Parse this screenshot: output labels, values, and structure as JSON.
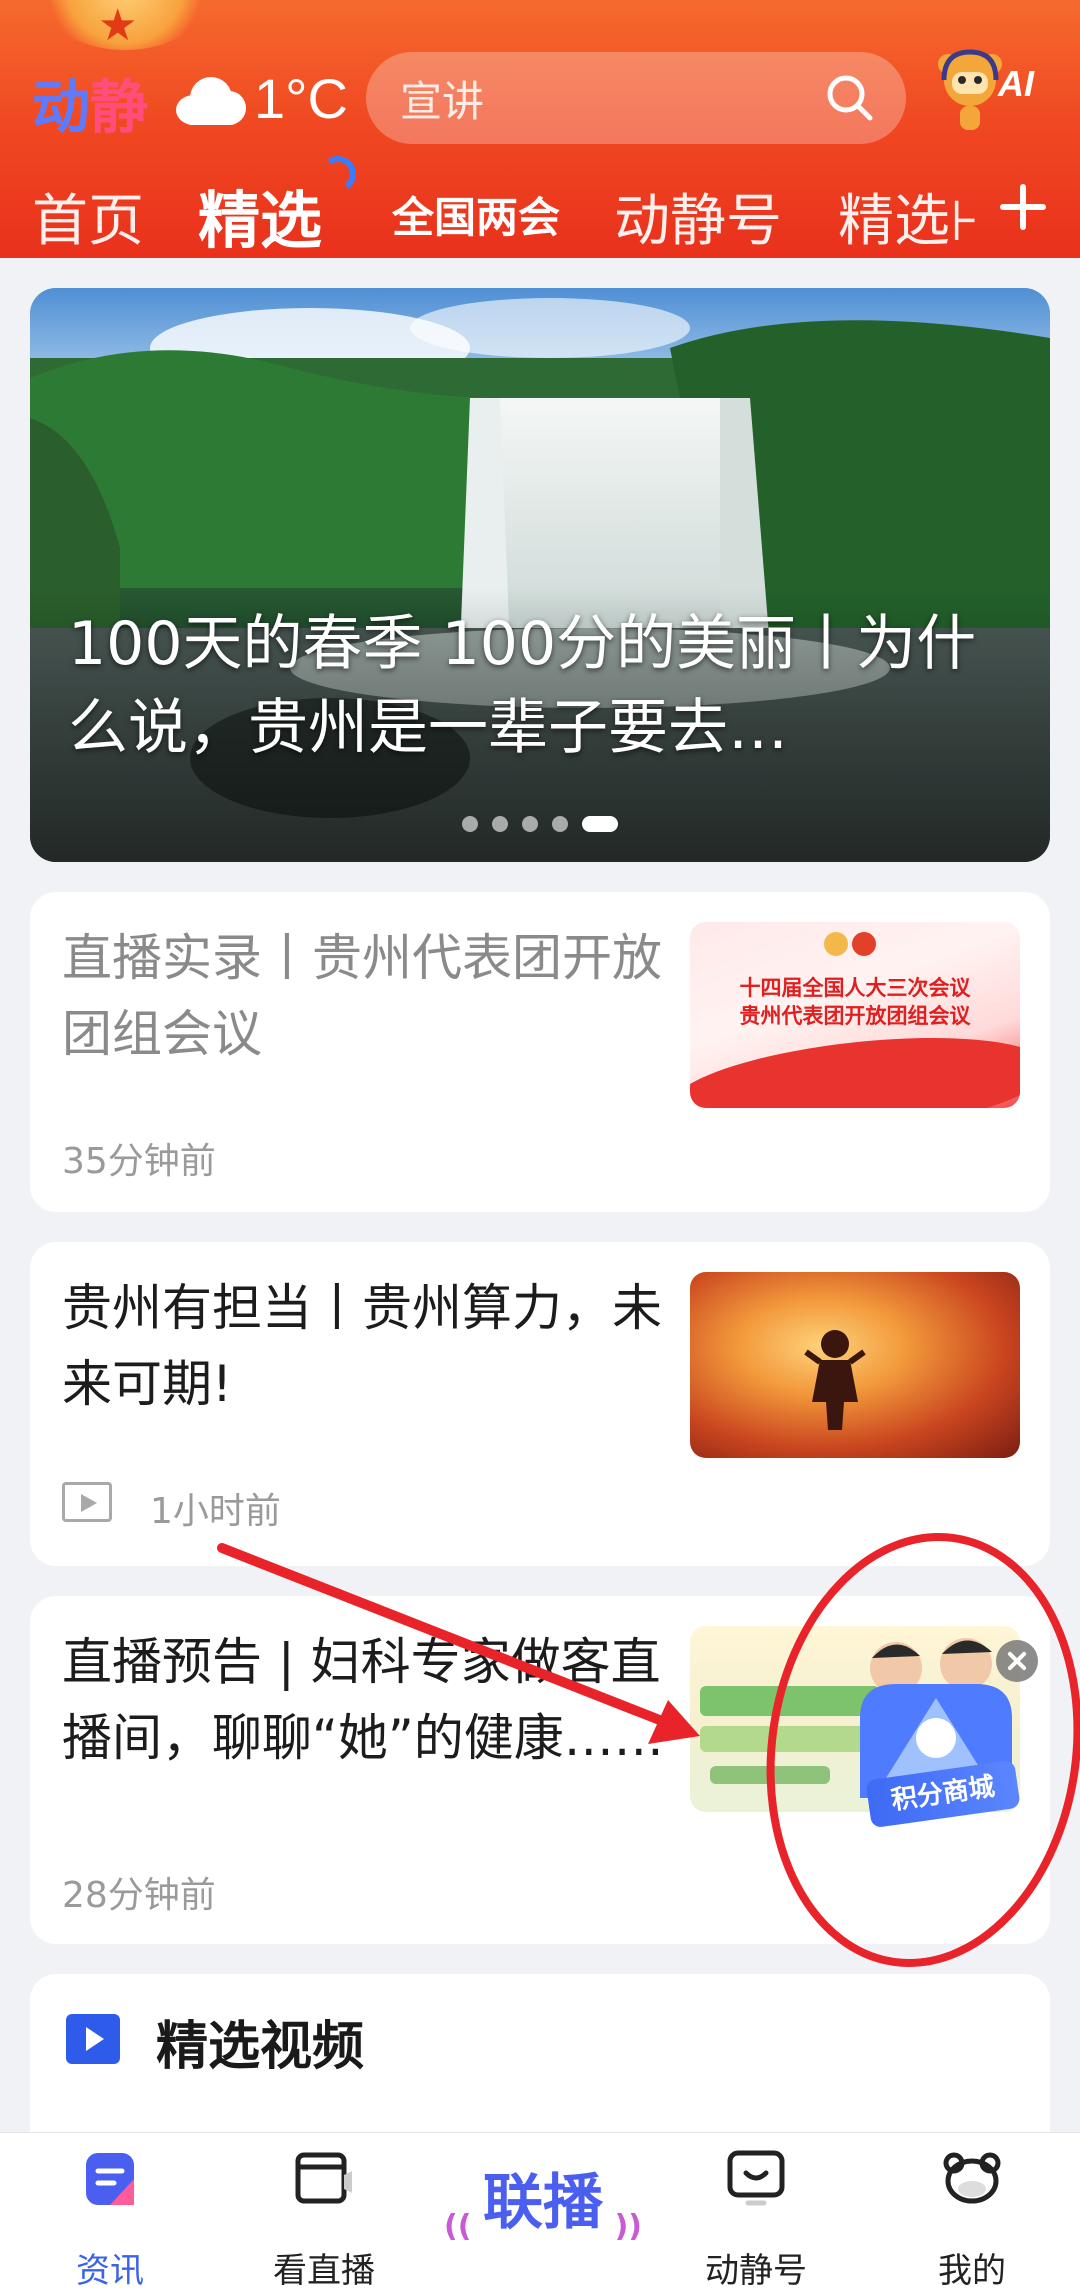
{
  "header": {
    "logo": [
      "动",
      "静"
    ],
    "weather": {
      "icon": "cloud-icon",
      "temperature": "1°C"
    },
    "search": {
      "placeholder": "宣讲",
      "icon": "search-icon"
    },
    "ai_badge": "AI",
    "tabs": [
      {
        "label": "首页",
        "active": false
      },
      {
        "label": "精选",
        "active": true
      },
      {
        "label": "全国两会",
        "active": false
      },
      {
        "label": "动静号",
        "active": false
      },
      {
        "label": "精选⊦",
        "active": false
      }
    ],
    "add_icon": "plus-icon"
  },
  "banner": {
    "title": "100天的春季 100分的美丽丨为什么说，贵州是一辈子要去…",
    "dot_count": 5,
    "active_dot": 5
  },
  "feed": [
    {
      "headline": "直播实录丨贵州代表团开放团组会议",
      "time": "35分钟前",
      "read": true,
      "thumb_text": [
        "十四届全国人大三次会议",
        "贵州代表团开放团组会议"
      ]
    },
    {
      "headline": "贵州有担当丨贵州算力，未来可期!",
      "time": "1小时前",
      "read": false,
      "video": true
    },
    {
      "headline": "直播预告 | 妇科专家做客直播间，聊聊“她”的健康……",
      "time": "28分钟前",
      "read": false
    }
  ],
  "floating_widget": {
    "label": "积分商城",
    "close_icon": "close-icon"
  },
  "video_section": {
    "title": "精选视频",
    "icon": "play-icon"
  },
  "bottom_nav": [
    {
      "label": "资讯",
      "icon": "news-icon",
      "active": true
    },
    {
      "label": "看直播",
      "icon": "live-tv-icon",
      "active": false
    },
    {
      "label": "联播",
      "icon": "lianbo-logo",
      "active": false
    },
    {
      "label": "动静号",
      "icon": "chat-tv-icon",
      "active": false
    },
    {
      "label": "我的",
      "icon": "profile-mascot-icon",
      "active": false
    }
  ],
  "colors": {
    "header_red": "#e9301c",
    "accent_blue": "#3a63e8",
    "annotation_red": "#e8232a"
  }
}
